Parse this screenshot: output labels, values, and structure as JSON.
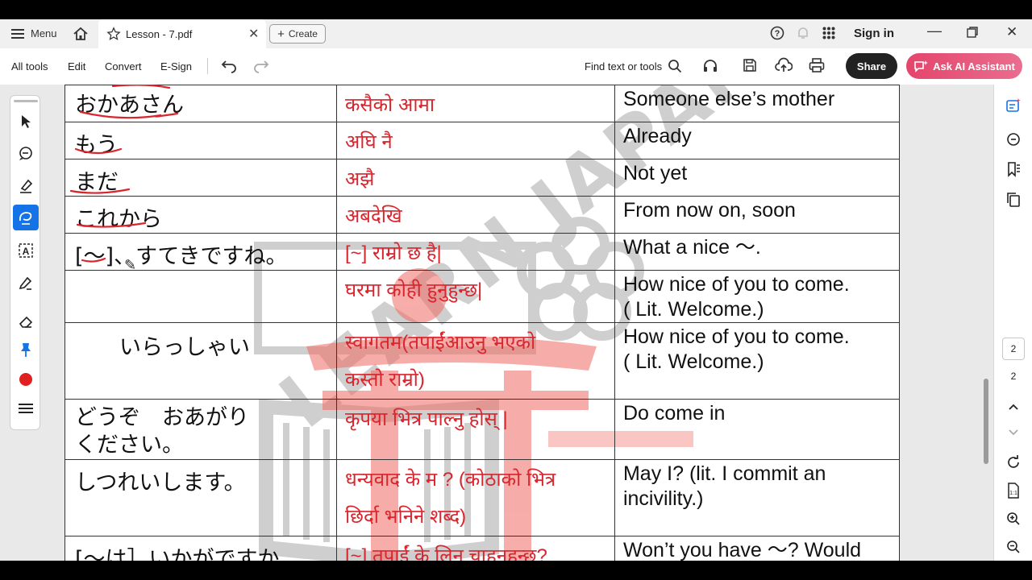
{
  "tabbar": {
    "menu_label": "Menu",
    "tab_title": "Lesson - 7.pdf",
    "create_label": "Create",
    "sign_in_label": "Sign in"
  },
  "toolbar": {
    "all_tools": "All tools",
    "edit": "Edit",
    "convert": "Convert",
    "esign": "E-Sign",
    "find_text": "Find text or tools",
    "share": "Share",
    "ai_assistant": "Ask AI Assistant"
  },
  "document": {
    "watermark_text": "LEARN JAPANESE",
    "rows": [
      {
        "jp": "おかあさん",
        "np": "कसैको आमा",
        "en": "Someone else’s mother"
      },
      {
        "jp": "もう",
        "np": "अघि नै",
        "en": "Already"
      },
      {
        "jp": "まだ",
        "np": "अझै",
        "en": "Not yet"
      },
      {
        "jp": "これから",
        "np": "अबदेखि",
        "en": "From now on, soon"
      },
      {
        "jp": "[～]、すてきですね。",
        "np": "[~] राम्रो छ है|",
        "en": "What a nice ～."
      },
      {
        "jp": "",
        "np": "घरमा कोही हुनुहुन्छ|",
        "en": "How nice of you to come.\n( Lit. Welcome.)"
      },
      {
        "jp": "いらっしゃい",
        "np": "स्वागतम(तपाईंआउनु भएको\nकस्तो राम्रो)",
        "en": "How nice of you to come.\n( Lit. Welcome.)"
      },
      {
        "jp": "どうぞ　おあがり\nください。",
        "np": "कृपया भित्र पाल्नु होस् |",
        "en": "Do come in"
      },
      {
        "jp": "しつれいします。",
        "np": "धन्यवाद के म ? (कोठाको भित्र\nछिर्दा भनिने शब्द)",
        "en": "May I? (lit. I commit an\nincivility.)"
      },
      {
        "jp": "[～は］いかがですか。",
        "np": "[~] तपाईं के लिन चाहनुहुन्छ?",
        "en": "Won’t you have ～? Would"
      }
    ]
  },
  "rightrail": {
    "page_input": "2",
    "page_total": "2"
  },
  "colors": {
    "accent": "#1473e6",
    "nepali_text": "#d9252e",
    "ai_gradient_start": "#e4456b",
    "share_bg": "#222222"
  }
}
